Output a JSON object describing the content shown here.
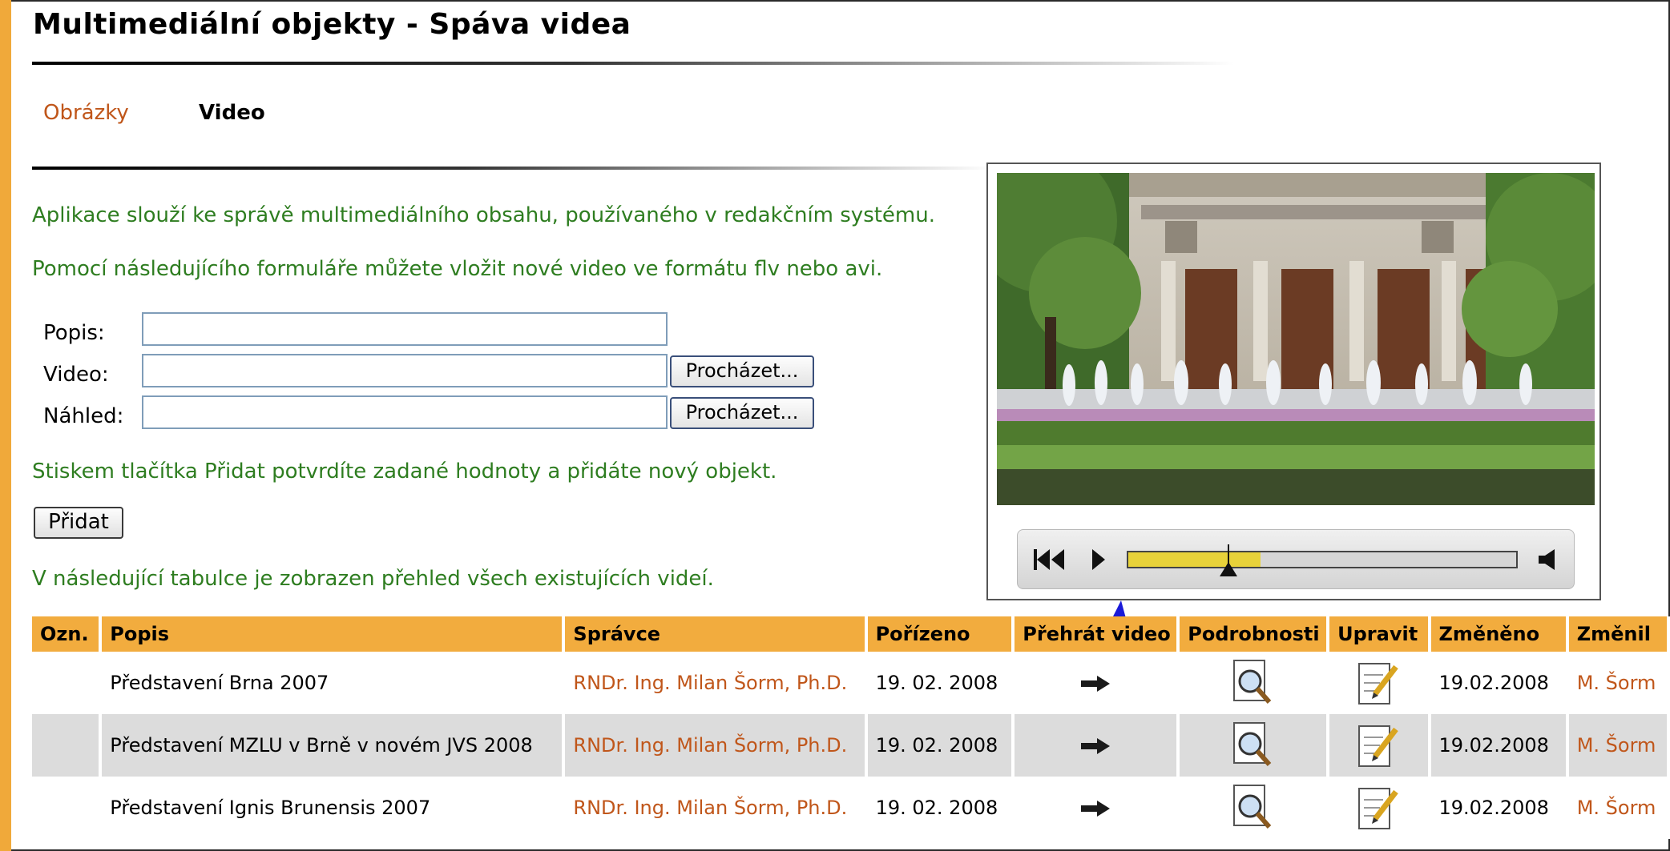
{
  "page": {
    "title": "Multimediální objekty - Spáva videa"
  },
  "tabs": [
    {
      "label": "Obrázky",
      "active": false
    },
    {
      "label": "Video",
      "active": true
    }
  ],
  "intro": {
    "line1": "Aplikace slouží ke správě multimediálního obsahu, používaného v redakčním systému.",
    "line2": "Pomocí následujícího formuláře můžete vložit nové video ve formátu flv nebo avi."
  },
  "form": {
    "description_label": "Popis:",
    "description_value": "",
    "video_label": "Video:",
    "video_value": "",
    "preview_label": "Náhled:",
    "preview_value": "",
    "browse_label": "Procházet...",
    "confirm_text": "Stiskem tlačítka Přidat potvrdíte zadané hodnoty a přidáte nový objekt.",
    "submit_label": "Přidat"
  },
  "table_intro": "V následující tabulce je zobrazen přehled všech existujících videí.",
  "player": {
    "progress_fraction": 0.34,
    "played_fraction": 0.26,
    "controls": [
      "rewind-icon",
      "play-icon",
      "volume-icon"
    ]
  },
  "table": {
    "columns": [
      "Ozn.",
      "Popis",
      "Správce",
      "Pořízeno",
      "Přehrát video",
      "Podrobnosti",
      "Upravit",
      "Změněno",
      "Změnil"
    ],
    "rows": [
      {
        "mark": "",
        "description": "Představení Brna 2007",
        "admin": "RNDr. Ing. Milan Šorm, Ph.D.",
        "recorded": "19. 02. 2008",
        "changed": "19.02.2008",
        "changed_by": "M. Šorm"
      },
      {
        "mark": "",
        "description": "Představení MZLU v Brně v novém JVS 2008",
        "admin": "RNDr. Ing. Milan Šorm, Ph.D.",
        "recorded": "19. 02. 2008",
        "changed": "19.02.2008",
        "changed_by": "M. Šorm"
      },
      {
        "mark": "",
        "description": "Představení Ignis Brunensis 2007",
        "admin": "RNDr. Ing. Milan Šorm, Ph.D.",
        "recorded": "19. 02. 2008",
        "changed": "19.02.2008",
        "changed_by": "M. Šorm"
      }
    ]
  },
  "colors": {
    "accent": "#f0a93a",
    "table_header": "#f2ac3e",
    "link": "#c0561a",
    "info_text": "#2e7d20",
    "annotation": "#1a1ad8"
  }
}
